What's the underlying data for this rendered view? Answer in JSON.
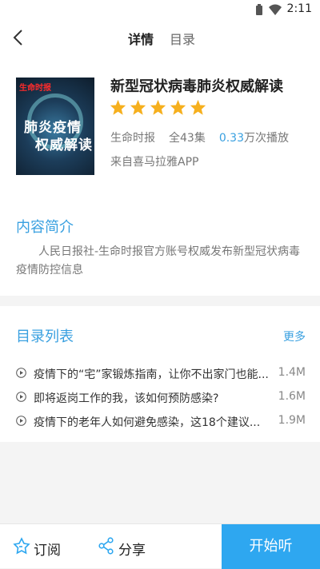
{
  "status_bar": {
    "time": "2:11",
    "wifi_icon": "wifi-icon",
    "battery_icon": "battery-icon"
  },
  "navbar": {
    "back_icon": "back-arrow-icon",
    "tabs": [
      {
        "label": "详情",
        "active": true
      },
      {
        "label": "目录",
        "active": false
      }
    ]
  },
  "album": {
    "cover": {
      "tag": "生命时报",
      "line1": "肺炎疫情",
      "line2": "权威解读"
    },
    "title": "新型冠状病毒肺炎权威解读",
    "rating_stars": 5,
    "publisher": "生命时报",
    "episodes": "全43集",
    "plays_number": "0.33",
    "plays_unit": "万次播放",
    "source": "来自喜马拉雅APP"
  },
  "intro": {
    "heading": "内容简介",
    "text": "人民日报社-生命时报官方账号权威发布新型冠状病毒疫情防控信息"
  },
  "episode_list": {
    "heading": "目录列表",
    "more_label": "更多",
    "items": [
      {
        "title": "疫情下的“宅”家锻炼指南，让你不出家门也能...",
        "size": "1.4M"
      },
      {
        "title": "即将返岗工作的我，该如何预防感染?",
        "size": "1.6M"
      },
      {
        "title": "疫情下的老年人如何避免感染，这18个建议...",
        "size": "1.9M"
      }
    ]
  },
  "bottom_bar": {
    "subscribe_label": "订阅",
    "share_label": "分享",
    "listen_label": "开始听"
  },
  "colors": {
    "accent": "#39a0e0",
    "listen_button": "#2ea7f0",
    "star": "#f6b01e"
  }
}
